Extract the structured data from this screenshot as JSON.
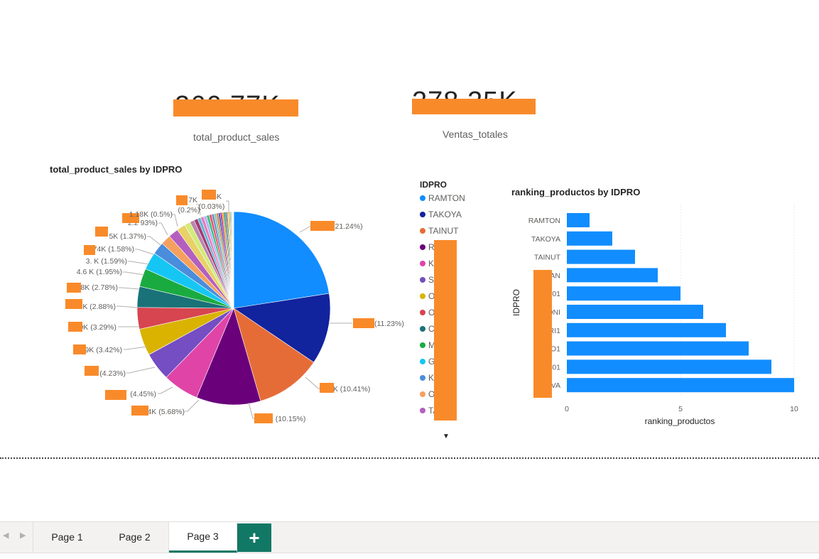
{
  "cards": [
    {
      "value": "266.77K",
      "label": "total_product_sales"
    },
    {
      "value": "278.25K",
      "label": "Ventas_totales"
    }
  ],
  "pie_visual": {
    "title": "total_product_sales by IDPRO",
    "labels": [
      {
        "text": "(21.24%)"
      },
      {
        "text": "(11.23%)"
      },
      {
        "text": "4K (10.41%)"
      },
      {
        "text": "4K (10.15%)"
      },
      {
        "text": "4K (5.68%)"
      },
      {
        "text": "(4.45%)"
      },
      {
        "text": "2K (4.23%)"
      },
      {
        "text": "9K (3.42%)"
      },
      {
        "text": "9K (3.29%)"
      },
      {
        "text": "K (2.88%)"
      },
      {
        "text": "8K (2.78%)"
      },
      {
        "text": "4.6 K (1.95%)"
      },
      {
        "text": "3. K (1.59%)"
      },
      {
        "text": "74K (1.58%)"
      },
      {
        "text": "5K (1.37%)"
      },
      {
        "text": "2.2 93%)"
      },
      {
        "text": "1.18K (0.5%)"
      },
      {
        "text": "7K"
      },
      {
        "text": "(0.2%)"
      },
      {
        "text": "6K"
      },
      {
        "text": "(0.03%)"
      }
    ]
  },
  "legend": {
    "title": "IDPRO",
    "items": [
      {
        "label": "RAMTON",
        "color": "#118dff"
      },
      {
        "label": "TAKOYA",
        "color": "#12239e"
      },
      {
        "label": "TAINUT",
        "color": "#e66c37"
      },
      {
        "label": "R N",
        "color": "#6b007b"
      },
      {
        "label": "KA",
        "color": "#e044a7"
      },
      {
        "label": "SI",
        "color": "#744ec2"
      },
      {
        "label": "O 1",
        "color": "#d9b300"
      },
      {
        "label": "O 1",
        "color": "#d64550"
      },
      {
        "label": "C 1",
        "color": "#197278"
      },
      {
        "label": "M VA",
        "color": "#1aab40"
      },
      {
        "label": "G 1",
        "color": "#15c6f4"
      },
      {
        "label": "KA",
        "color": "#4a8ddc"
      },
      {
        "label": "O OM",
        "color": "#f5a05e"
      },
      {
        "label": "TA",
        "color": "#b45fbf"
      }
    ]
  },
  "bar_visual": {
    "title": "ranking_productos by IDPRO",
    "y_axis_title": "IDPRO",
    "x_axis_title": "ranking_productos",
    "x_ticks": [
      "0",
      "5",
      "10"
    ],
    "category_labels": [
      "RAMTON",
      "TAKOYA",
      "TAINUT",
      "R AN",
      "01",
      "ONI",
      "RI1",
      "O1",
      "01",
      "M VA"
    ]
  },
  "chart_data": [
    {
      "type": "pie",
      "title": "total_product_sales by IDPRO",
      "slices_percent": [
        21.24,
        11.23,
        10.41,
        10.15,
        5.68,
        4.45,
        4.23,
        3.42,
        3.29,
        2.88,
        2.78,
        1.95,
        1.59,
        1.58,
        1.37,
        0.93,
        0.7,
        0.6,
        0.5,
        0.5,
        0.45,
        0.42,
        0.4,
        0.38,
        0.35,
        0.33,
        0.3,
        0.28,
        0.26,
        0.24,
        0.22,
        0.2,
        0.18,
        0.16,
        0.14,
        0.12,
        0.1,
        0.08,
        0.06,
        0.05,
        0.03
      ],
      "colors": [
        "#118dff",
        "#12239e",
        "#e66c37",
        "#6b007b",
        "#e044a7",
        "#744ec2",
        "#d9b300",
        "#d64550",
        "#197278",
        "#1aab40",
        "#15c6f4",
        "#4a8ddc",
        "#f5a05e",
        "#b45fbf",
        "#e8d166",
        "#d2eb7b",
        "#b887ad",
        "#a43b76",
        "#5fb8d6",
        "#ea7bb8",
        "#b3b3f3",
        "#31c383",
        "#f24e66",
        "#6b90c9",
        "#7cc9b1",
        "#e07b39",
        "#3f51b5",
        "#9c27b0",
        "#ff9800",
        "#009688",
        "#795548",
        "#607d8b",
        "#cddc39",
        "#ff5722",
        "#8bc34a",
        "#2196f3",
        "#9e9e9e",
        "#673ab7",
        "#03a9f4",
        "#c2185b",
        "#cfcf3a"
      ]
    },
    {
      "type": "bar",
      "orientation": "horizontal",
      "title": "ranking_productos by IDPRO",
      "xlabel": "ranking_productos",
      "ylabel": "IDPRO",
      "values": [
        1,
        2,
        3,
        4,
        5,
        6,
        7,
        8,
        9,
        10
      ],
      "xlim": [
        0,
        10
      ],
      "color": "#118dff"
    }
  ],
  "tabs": [
    {
      "label": "Page 1",
      "active": false
    },
    {
      "label": "Page 2",
      "active": false
    },
    {
      "label": "Page 3",
      "active": true
    }
  ],
  "add_tab_label": "+",
  "nav": {
    "prev": "◀",
    "next": "▶"
  },
  "legend_more": "▼"
}
